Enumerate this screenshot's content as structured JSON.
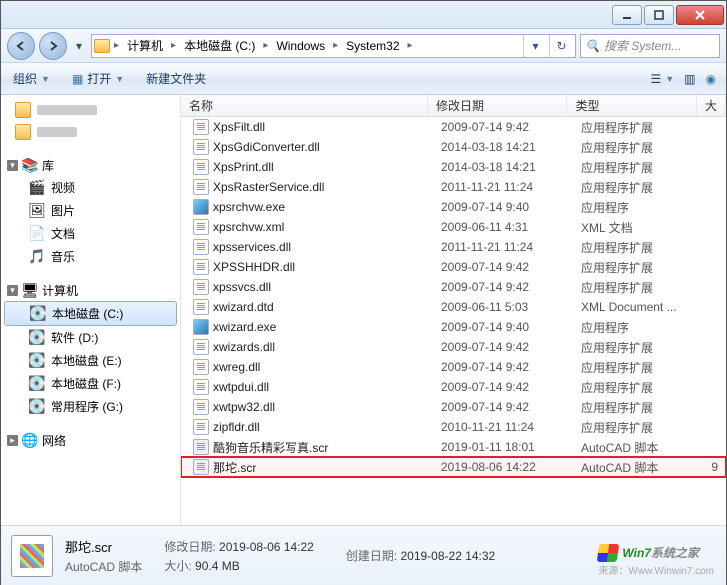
{
  "window": {
    "title": ""
  },
  "breadcrumb": {
    "items": [
      "计算机",
      "本地磁盘 (C:)",
      "Windows",
      "System32"
    ]
  },
  "search": {
    "placeholder": "搜索 System..."
  },
  "toolbar": {
    "organize": "组织",
    "open": "打开",
    "newfolder": "新建文件夹"
  },
  "sidebar": {
    "quick": {
      "items": []
    },
    "library": {
      "head": "库",
      "items": [
        {
          "icon": "🎬",
          "label": "视频"
        },
        {
          "icon": "🖼",
          "label": "图片"
        },
        {
          "icon": "📄",
          "label": "文档"
        },
        {
          "icon": "🎵",
          "label": "音乐"
        }
      ]
    },
    "computer": {
      "head": "计算机",
      "items": [
        {
          "label": "本地磁盘 (C:)",
          "selected": true
        },
        {
          "label": "软件 (D:)"
        },
        {
          "label": "本地磁盘 (E:)"
        },
        {
          "label": "本地磁盘 (F:)"
        },
        {
          "label": "常用程序 (G:)"
        }
      ]
    },
    "network": {
      "head": "网络"
    }
  },
  "columns": {
    "name": "名称",
    "date": "修改日期",
    "type": "类型",
    "size": "大"
  },
  "files": [
    {
      "name": "XpsFilt.dll",
      "date": "2009-07-14 9:42",
      "type": "应用程序扩展",
      "ico": "dll"
    },
    {
      "name": "XpsGdiConverter.dll",
      "date": "2014-03-18 14:21",
      "type": "应用程序扩展",
      "ico": "dll"
    },
    {
      "name": "XpsPrint.dll",
      "date": "2014-03-18 14:21",
      "type": "应用程序扩展",
      "ico": "dll"
    },
    {
      "name": "XpsRasterService.dll",
      "date": "2011-11-21 11:24",
      "type": "应用程序扩展",
      "ico": "dll"
    },
    {
      "name": "xpsrchvw.exe",
      "date": "2009-07-14 9:40",
      "type": "应用程序",
      "ico": "exe"
    },
    {
      "name": "xpsrchvw.xml",
      "date": "2009-06-11 4:31",
      "type": "XML 文档",
      "ico": "dll"
    },
    {
      "name": "xpsservices.dll",
      "date": "2011-11-21 11:24",
      "type": "应用程序扩展",
      "ico": "dll"
    },
    {
      "name": "XPSSHHDR.dll",
      "date": "2009-07-14 9:42",
      "type": "应用程序扩展",
      "ico": "dll"
    },
    {
      "name": "xpssvcs.dll",
      "date": "2009-07-14 9:42",
      "type": "应用程序扩展",
      "ico": "dll"
    },
    {
      "name": "xwizard.dtd",
      "date": "2009-06-11 5:03",
      "type": "XML Document ...",
      "ico": "dll"
    },
    {
      "name": "xwizard.exe",
      "date": "2009-07-14 9:40",
      "type": "应用程序",
      "ico": "exe"
    },
    {
      "name": "xwizards.dll",
      "date": "2009-07-14 9:42",
      "type": "应用程序扩展",
      "ico": "dll"
    },
    {
      "name": "xwreg.dll",
      "date": "2009-07-14 9:42",
      "type": "应用程序扩展",
      "ico": "dll"
    },
    {
      "name": "xwtpdui.dll",
      "date": "2009-07-14 9:42",
      "type": "应用程序扩展",
      "ico": "dll"
    },
    {
      "name": "xwtpw32.dll",
      "date": "2009-07-14 9:42",
      "type": "应用程序扩展",
      "ico": "dll"
    },
    {
      "name": "zipfldr.dll",
      "date": "2010-11-21 11:24",
      "type": "应用程序扩展",
      "ico": "dll"
    },
    {
      "name": "酷狗音乐精彩写真.scr",
      "date": "2019-01-11 18:01",
      "type": "AutoCAD 脚本",
      "ico": "scr"
    },
    {
      "name": "那坨.scr",
      "date": "2019-08-06 14:22",
      "type": "AutoCAD 脚本",
      "size": "9",
      "ico": "scr",
      "hl": true
    }
  ],
  "details": {
    "filename": "那坨.scr",
    "filetype": "AutoCAD 脚本",
    "mod_label": "修改日期:",
    "mod_val": "2019-08-06 14:22",
    "create_label": "创建日期:",
    "create_val": "2019-08-22 14:32",
    "size_label": "大小:",
    "size_val": "90.4 MB"
  },
  "watermark": {
    "brand": "Win7",
    "tail": "系统之家",
    "url": "来源：Www.Winwin7.com"
  }
}
